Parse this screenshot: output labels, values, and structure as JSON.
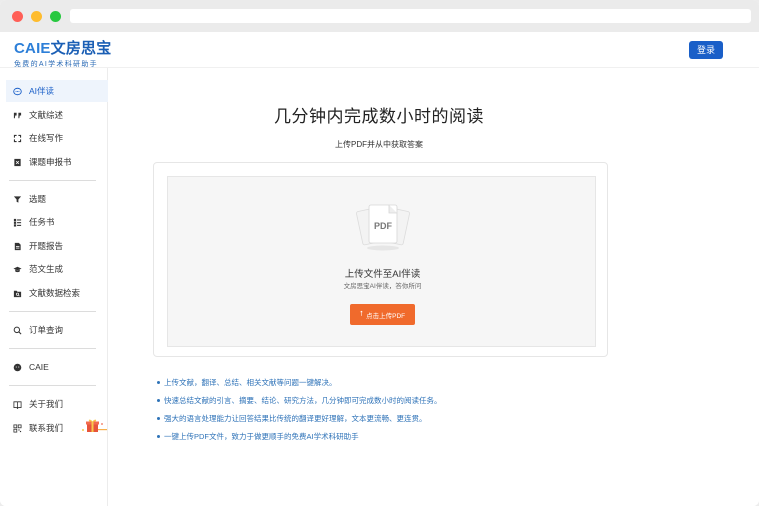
{
  "logo": {
    "brand_latin": "CAIE",
    "brand_cn": "文房思宝",
    "tagline": "免费的AI学术科研助手"
  },
  "header": {
    "login_label": "登录"
  },
  "sidebar": {
    "items": [
      {
        "label": "AI伴读",
        "icon": "chat-bubble-icon"
      },
      {
        "label": "文献综述",
        "icon": "quote-icon"
      },
      {
        "label": "在线写作",
        "icon": "edit-frame-icon"
      },
      {
        "label": "课题申报书",
        "icon": "book-icon"
      },
      {
        "label": "选题",
        "icon": "filter-icon"
      },
      {
        "label": "任务书",
        "icon": "tasks-icon"
      },
      {
        "label": "开题报告",
        "icon": "report-icon"
      },
      {
        "label": "范文生成",
        "icon": "graduation-cap-icon"
      },
      {
        "label": "文献数据检索",
        "icon": "folder-search-icon"
      },
      {
        "label": "订单查询",
        "icon": "search-icon"
      },
      {
        "label": "CAIE",
        "icon": "wechat-icon"
      },
      {
        "label": "关于我们",
        "icon": "info-book-icon"
      },
      {
        "label": "联系我们",
        "icon": "qrcode-icon"
      }
    ]
  },
  "main": {
    "headline": "几分钟内完成数小时的阅读",
    "subline": "上传PDF并从中获取答案",
    "upload": {
      "icon_text": "PDF",
      "title": "上传文件至AI伴读",
      "description": "文房思宝AI伴读，答你所问",
      "button_label": "点击上传PDF"
    },
    "features": [
      "上传文献，翻译、总结、相关文献等问题一键解决。",
      "快速总结文献的引言、摘要、结论、研究方法，几分钟即可完成数小时的阅读任务。",
      "强大的语言处理能力让回答结果比传统的翻译更好理解，文本更流畅、更连贯。",
      "一键上传PDF文件，致力于做更顺手的免费AI学术科研助手"
    ]
  },
  "colors": {
    "accent": "#1a5fc8",
    "upload_button": "#f06a2c",
    "feature_text": "#2f73b8"
  }
}
